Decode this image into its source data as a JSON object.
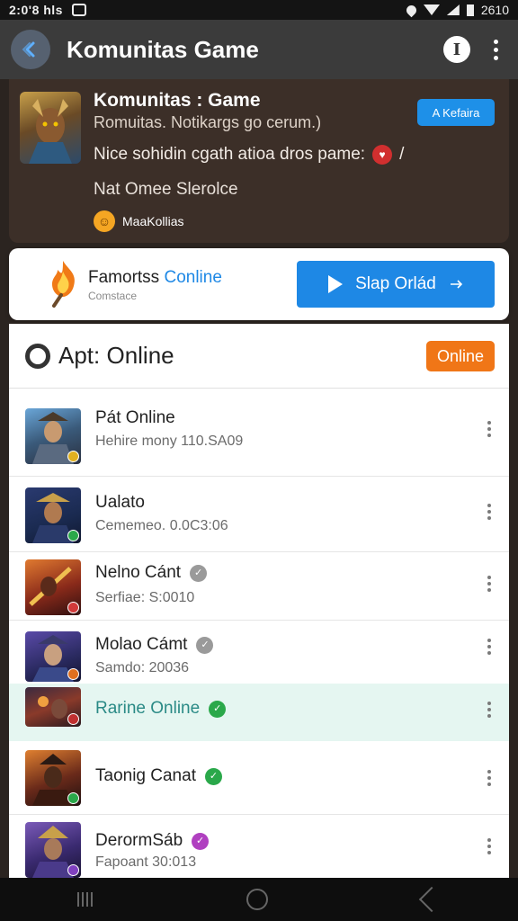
{
  "status_bar": {
    "time": "2:0'8 hls",
    "right_text": "2610"
  },
  "app_bar": {
    "title": "Komunitas Game",
    "info_label": "I"
  },
  "hero": {
    "title": "Komunitas : Game",
    "subtitle": "Romuitas. Notikargs go cerum.)",
    "description": "Nice sohidin cgath atioa dros pame:",
    "description_tail": "/",
    "service": "Nat Omee Slerolce",
    "tag": "MaaKollias",
    "action_label": "A Kefaira",
    "colors": {
      "background": "#3c2f28",
      "action": "#1e90e8"
    }
  },
  "banner": {
    "name": "Famortss",
    "name_accent": "Conline",
    "subtitle": "Comstace",
    "button_label": "Slap Orlád",
    "colors": {
      "button": "#1e88e5"
    }
  },
  "panel": {
    "title": "Apt: Online",
    "badge": "Online",
    "colors": {
      "badge": "#f07617",
      "highlight": "#e5f6f1"
    }
  },
  "list": [
    {
      "title": "Pát Online",
      "subtitle": "Hehire mony 110.SA09",
      "mark_color": "#e0b020"
    },
    {
      "title": "Ualato",
      "subtitle": "Cememeo. 0.0C3:06",
      "mark_color": "#2aa84a"
    },
    {
      "title": "Nelno Cánt",
      "subtitle": "Serfiae: S:0010",
      "mark_color": "#d13a3a",
      "badge_color": "#9a9a9a"
    },
    {
      "title": "Molao Cámt",
      "subtitle": "Samdo: 20036",
      "mark_color": "#e07020",
      "badge_color": "#9a9a9a"
    },
    {
      "title": "Rarine Online",
      "subtitle": "",
      "mark_color": "#c03030",
      "badge_color": "#2aa84a",
      "highlight": true
    },
    {
      "title": "Taonig Canat",
      "subtitle": "",
      "mark_color": "#2aa84a",
      "badge_color": "#2aa84a"
    },
    {
      "title": "DerormSáb",
      "subtitle": "Fapoant 30:013",
      "mark_color": "#8040c0",
      "badge_color": "#b040c0"
    }
  ]
}
